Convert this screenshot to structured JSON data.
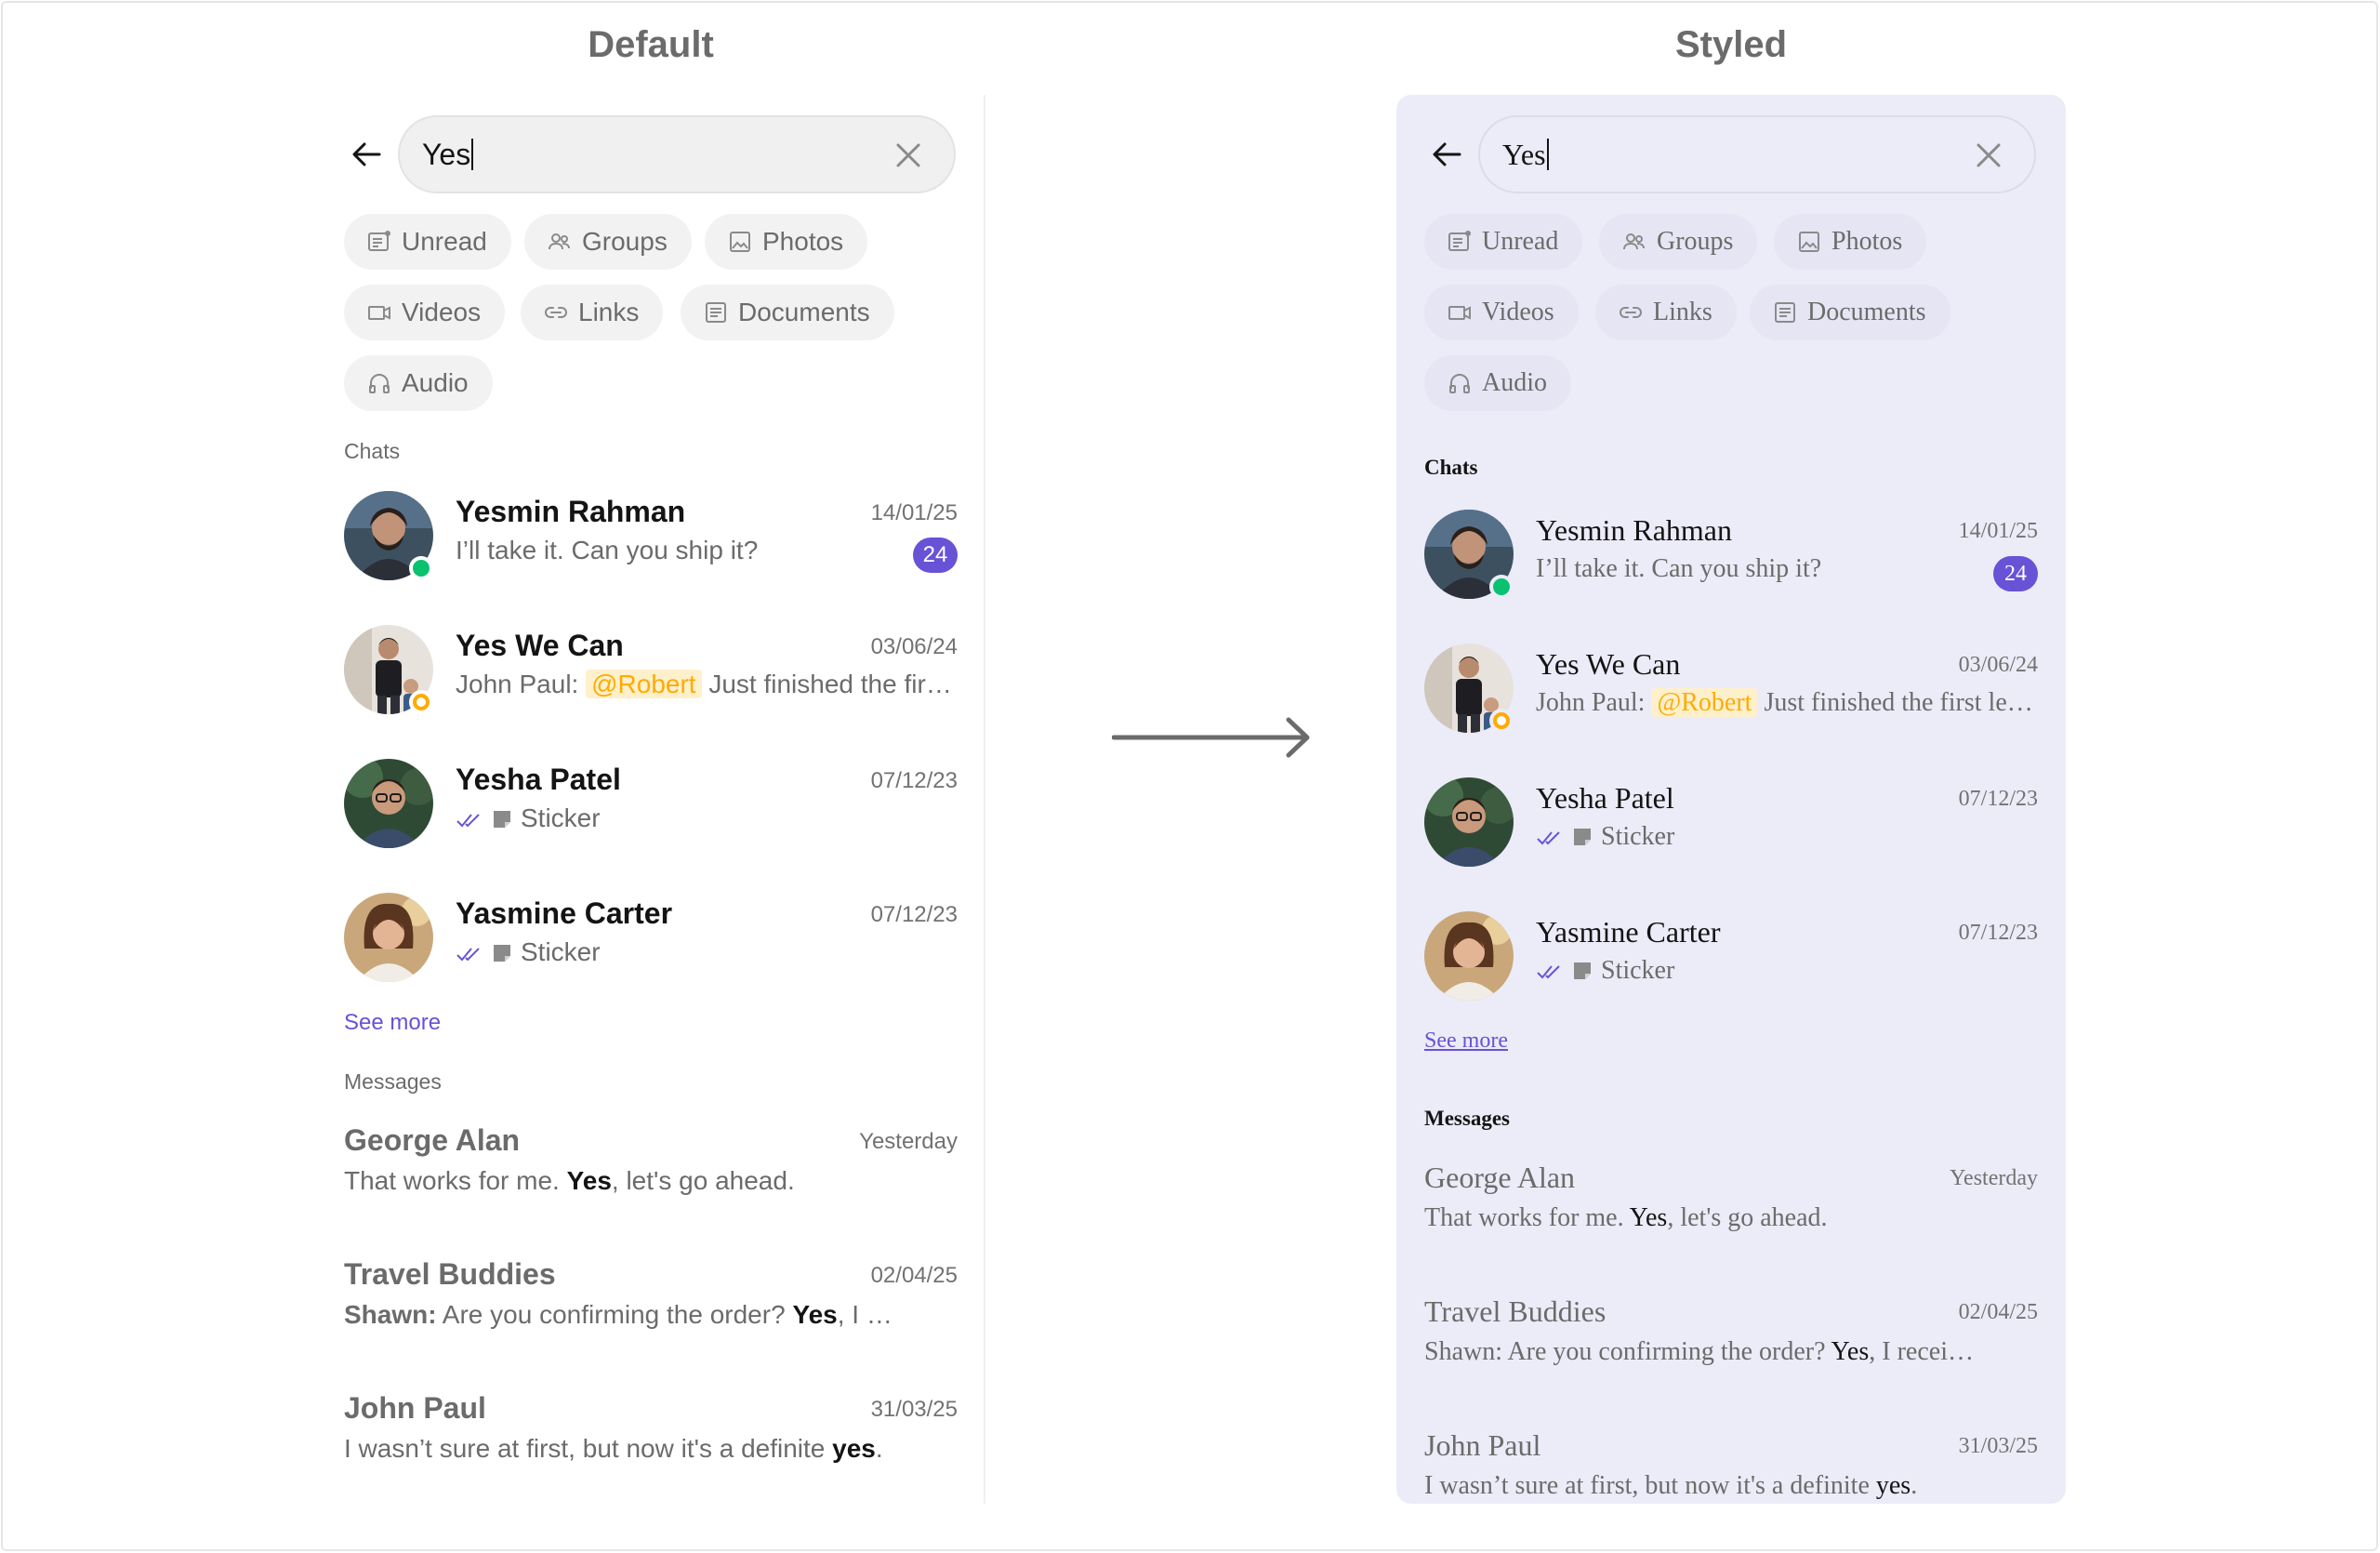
{
  "labels": {
    "default": "Default",
    "styled": "Styled"
  },
  "search": {
    "value": "Yes"
  },
  "chips": [
    "Unread",
    "Groups",
    "Photos",
    "Videos",
    "Links",
    "Documents",
    "Audio"
  ],
  "sections": {
    "chats": "Chats",
    "messages": "Messages",
    "see_more": "See more"
  },
  "chats": [
    {
      "name": "Yesmin Rahman",
      "date": "14/01/25",
      "preview": "I’ll take it. Can you ship it?",
      "badge": "24",
      "status": "online"
    },
    {
      "name": "Yes We Can",
      "date": "03/06/24",
      "sender": "John Paul:",
      "mention": "@Robert",
      "preview": " Just finished the first lesson",
      "status": "group"
    },
    {
      "name": "Yesha Patel",
      "date": "07/12/23",
      "preview": "Sticker"
    },
    {
      "name": "Yasmine Carter",
      "date": "07/12/23",
      "preview": "Sticker"
    }
  ],
  "messages": [
    {
      "title": "George Alan",
      "date": "Yesterday",
      "before": "That works for me. ",
      "match": "Yes",
      "after": ", let's go ahead."
    },
    {
      "title": "Travel Buddies",
      "date": "02/04/25",
      "sender": "Shawn:",
      "before": " Are you confirming the order? ",
      "match": "Yes",
      "after": ", I received it"
    },
    {
      "title": "John Paul",
      "date": "31/03/25",
      "before": "I wasn’t sure at first, but now it's a definite ",
      "match": "yes",
      "after": "."
    }
  ],
  "colors": {
    "accent": "#6852d6",
    "online": "#09c26f",
    "group": "#ffab00",
    "styled_bg": "#ecebf8"
  }
}
